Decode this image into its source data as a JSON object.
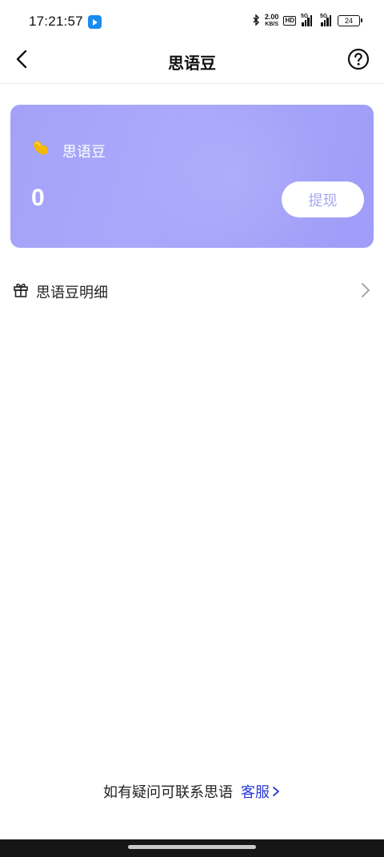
{
  "status_bar": {
    "time": "17:21:57",
    "net_speed_value": "2.00",
    "net_speed_unit": "KB/S",
    "hd_label": "HD",
    "sim1_label": "5G",
    "sim2_label": "5G",
    "battery": "24"
  },
  "nav": {
    "title": "思语豆"
  },
  "balance_card": {
    "label": "思语豆",
    "value": "0",
    "withdraw_label": "提现"
  },
  "detail": {
    "label": "思语豆明细"
  },
  "footer": {
    "text": "如有疑问可联系思语",
    "link_label": "客服"
  },
  "colors": {
    "card_background": "#a4a3f9",
    "withdraw_text": "#a8a6f4",
    "link": "#2b3bd6",
    "bean": "#f5b800"
  }
}
